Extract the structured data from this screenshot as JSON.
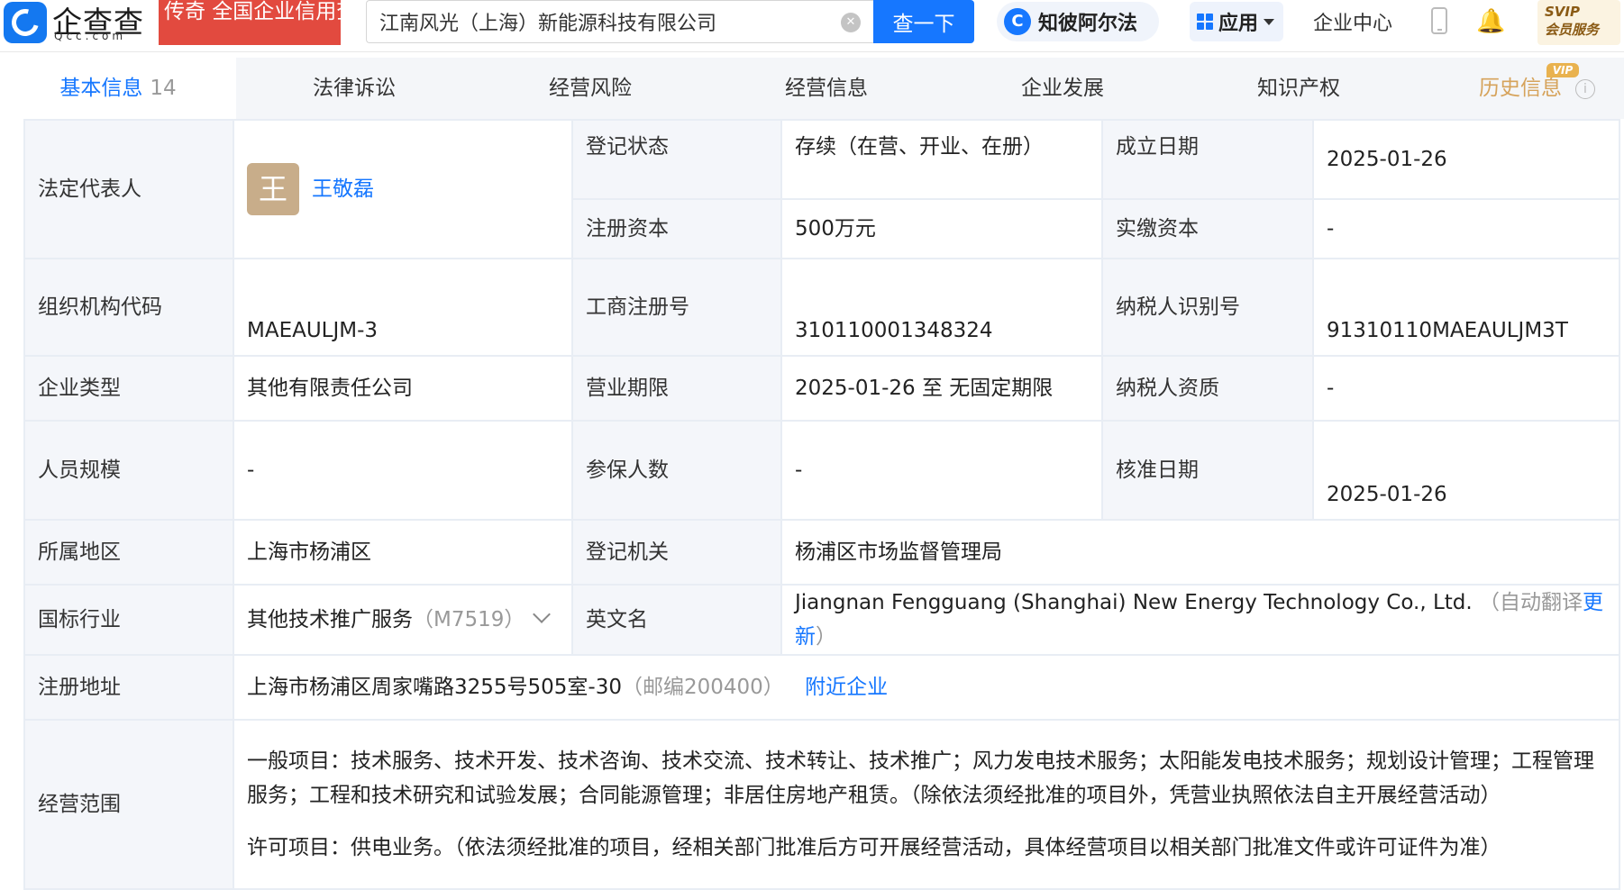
{
  "header": {
    "brand_cn": "企查查",
    "brand_en": "Qcc.com",
    "slogan": "传奇 全国企业信用查询",
    "search_value": "江南风光（上海）新能源科技有限公司",
    "search_button": "查一下",
    "zbaef_label": "知彼阿尔法",
    "app_label": "应用",
    "enterprise_center": "企业中心",
    "svip_top": "SVIP",
    "svip_bottom": "会员服务"
  },
  "tabs": [
    {
      "label": "基本信息",
      "count": "14"
    },
    {
      "label": "法律诉讼"
    },
    {
      "label": "经营风险"
    },
    {
      "label": "经营信息"
    },
    {
      "label": "企业发展"
    },
    {
      "label": "知识产权"
    },
    {
      "label": "历史信息"
    }
  ],
  "vip_badge": "VIP",
  "info_symbol": "i",
  "basic": {
    "legal_rep_label": "法定代表人",
    "legal_rep_avatar": "王",
    "legal_rep_name": "王敬磊",
    "reg_status_label": "登记状态",
    "reg_status": "存续（在营、开业、在册）",
    "est_date_label": "成立日期",
    "est_date": "2025-01-26",
    "reg_capital_label": "注册资本",
    "reg_capital": "500万元",
    "paid_capital_label": "实缴资本",
    "paid_capital": "-",
    "org_code_label": "组织机构代码",
    "org_code": "MAEAULJM-3",
    "biz_reg_no_label": "工商注册号",
    "biz_reg_no": "310110001348324",
    "taxpayer_id_label": "纳税人识别号",
    "taxpayer_id": "91310110MAEAULJM3T",
    "ent_type_label": "企业类型",
    "ent_type": "其他有限责任公司",
    "biz_term_label": "营业期限",
    "biz_term": "2025-01-26 至 无固定期限",
    "taxpayer_qual_label": "纳税人资质",
    "taxpayer_qual": "-",
    "staff_size_label": "人员规模",
    "staff_size": "-",
    "insured_label": "参保人数",
    "insured": "-",
    "approval_date_label": "核准日期",
    "approval_date": "2025-01-26",
    "region_label": "所属地区",
    "region": "上海市杨浦区",
    "reg_authority_label": "登记机关",
    "reg_authority": "杨浦区市场监督管理局",
    "industry_label": "国标行业",
    "industry": "其他技术推广服务",
    "industry_code": "（M7519）",
    "english_name_label": "英文名",
    "english_name": "Jiangnan Fengguang (Shanghai) New Energy Technology Co., Ltd.",
    "auto_translate_prefix": "（自动翻译",
    "auto_translate_link": "更新",
    "auto_translate_suffix": "）",
    "address_label": "注册地址",
    "address": "上海市杨浦区周家嘴路3255号505室-30",
    "postcode": "（邮编200400）",
    "nearby_link": "附近企业",
    "scope_label": "经营范围",
    "scope_general": "一般项目：技术服务、技术开发、技术咨询、技术交流、技术转让、技术推广；风力发电技术服务；太阳能发电技术服务；规划设计管理；工程管理服务；工程和技术研究和试验发展；合同能源管理；非居住房地产租赁。（除依法须经批准的项目外，凭营业执照依法自主开展经营活动）",
    "scope_licensed": "许可项目：供电业务。（依法须经批准的项目，经相关部门批准后方可开展经营活动，具体经营项目以相关部门批准文件或许可证件为准）"
  }
}
